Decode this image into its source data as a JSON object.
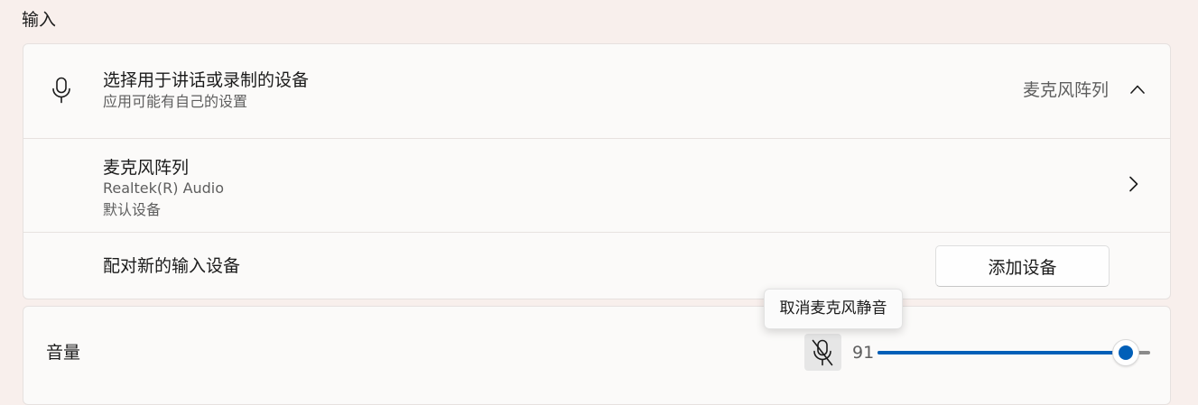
{
  "section_title": "输入",
  "input_select": {
    "title": "选择用于讲话或录制的设备",
    "subtitle": "应用可能有自己的设置",
    "selected_device": "麦克风阵列",
    "expanded": true
  },
  "device": {
    "name": "麦克风阵列",
    "driver": "Realtek(R) Audio",
    "status": "默认设备"
  },
  "pair": {
    "label": "配对新的输入设备",
    "button_label": "添加设备"
  },
  "volume": {
    "label": "音量",
    "value": 91,
    "value_text": "91",
    "muted": true
  },
  "tooltip": {
    "text": "取消麦克风静音"
  },
  "colors": {
    "accent": "#005fb8",
    "page_background": "#f8efec",
    "card_background": "#fbfaf9",
    "mute_button_background": "#e6e6e6"
  },
  "icons": {
    "input": "microphone-icon",
    "collapse": "chevron-up-icon",
    "device_details": "chevron-right-icon",
    "mute": "microphone-off-icon"
  }
}
